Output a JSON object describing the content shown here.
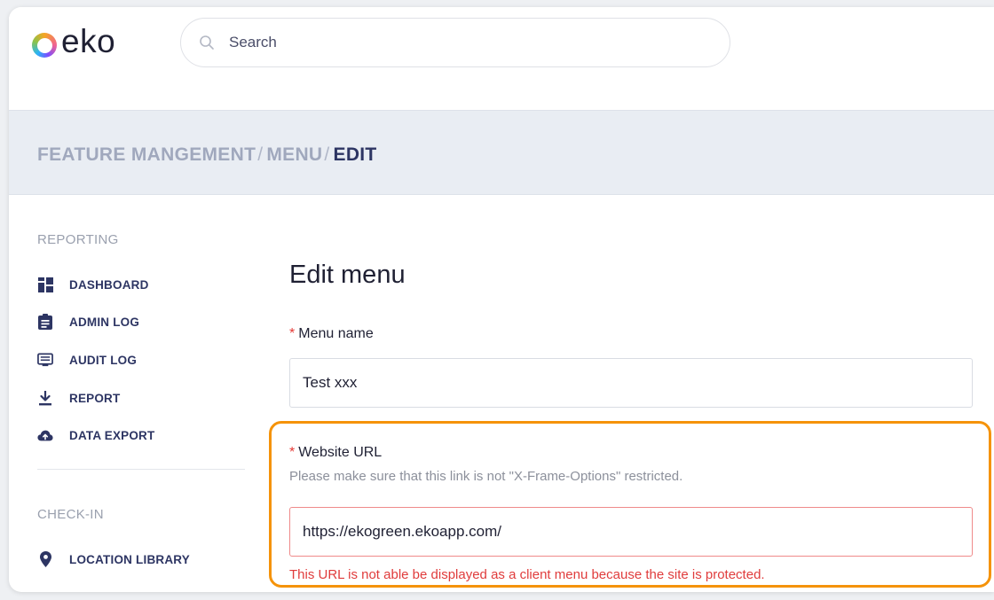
{
  "header": {
    "logo_text": "eko",
    "search_placeholder": "Search"
  },
  "breadcrumb": {
    "items": [
      "FEATURE MANGEMENT",
      "MENU",
      "EDIT"
    ],
    "separator": "/"
  },
  "sidebar": {
    "sections": [
      {
        "title": "REPORTING",
        "items": [
          {
            "label": "DASHBOARD",
            "icon": "dashboard-icon"
          },
          {
            "label": "ADMIN LOG",
            "icon": "clipboard-icon"
          },
          {
            "label": "AUDIT LOG",
            "icon": "list-icon"
          },
          {
            "label": "REPORT",
            "icon": "download-icon"
          },
          {
            "label": "DATA EXPORT",
            "icon": "cloud-upload-icon"
          }
        ]
      },
      {
        "title": "CHECK-IN",
        "items": [
          {
            "label": "LOCATION LIBRARY",
            "icon": "location-pin-icon"
          }
        ]
      }
    ]
  },
  "form": {
    "title": "Edit menu",
    "required_mark": "*",
    "menu_name": {
      "label": "Menu name",
      "value": "Test xxx"
    },
    "website_url": {
      "label": "Website URL",
      "hint": "Please make sure that this link is not \"X-Frame-Options\" restricted.",
      "value": "https://ekogreen.ekoapp.com/",
      "error": "This URL is not able be displayed as a client menu because the site is protected."
    }
  },
  "colors": {
    "accent_nav": "#2d3563",
    "error": "#e03c3c",
    "highlight": "#f5930a",
    "breadcrumb_bg": "#e9edf3"
  }
}
